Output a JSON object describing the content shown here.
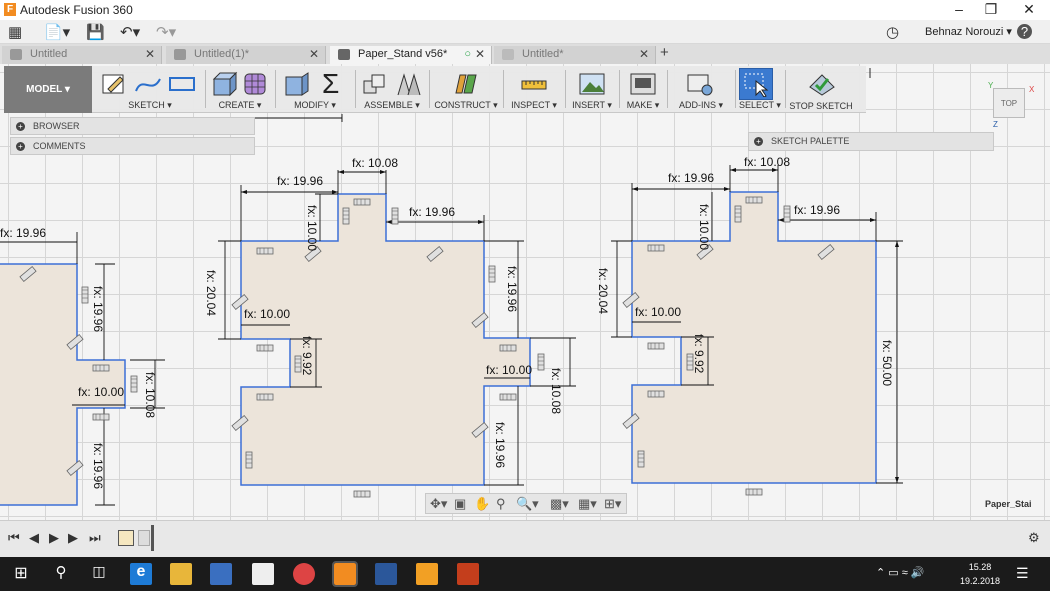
{
  "window": {
    "title": "Autodesk Fusion 360",
    "app_icon": "F"
  },
  "quick_access": {
    "user_name": "Behnaz Norouzi",
    "help": "?"
  },
  "tabs": [
    {
      "label": "Untitled",
      "active": false
    },
    {
      "label": "Untitled(1)*",
      "active": false
    },
    {
      "label": "Paper_Stand v56*",
      "active": true
    },
    {
      "label": "Untitled*",
      "active": false
    }
  ],
  "toolbar": {
    "workspace": "MODEL",
    "groups": [
      "SKETCH",
      "CREATE",
      "MODIFY",
      "ASSEMBLE",
      "CONSTRUCT",
      "INSPECT",
      "INSERT",
      "MAKE",
      "ADD-INS",
      "SELECT",
      "STOP SKETCH"
    ]
  },
  "panels": {
    "browser": "BROWSER",
    "comments": "COMMENTS",
    "sketch_palette": "SKETCH PALETTE"
  },
  "viewcube": {
    "face": "TOP",
    "axis_x": "X",
    "axis_y": "Y",
    "axis_z": "Z"
  },
  "document_name": "Paper_Stai",
  "dimensions": {
    "left": [
      "fx: 19.96",
      "fx: 19.96",
      "fx: 10.00",
      "fx: 10.08",
      "fx: 19.96"
    ],
    "middle": [
      "fx: 10.08",
      "fx: 19.96",
      "fx: 10.00",
      "fx: 19.96",
      "fx: 20.04",
      "fx: 19.96",
      "fx: 10.00",
      "fx: 9.92",
      "fx: 10.00",
      "fx: 10.08",
      "fx: 19.96"
    ],
    "right": [
      "fx: 10.08",
      "fx: 19.96",
      "fx: 10.00",
      "fx: 19.96",
      "fx: 20.04",
      "fx: 10.00",
      "fx: 9.92",
      "fx: 50.00"
    ]
  },
  "taskbar": {
    "time": "15.28",
    "date": "19.2.2018"
  },
  "colors": {
    "profile_fill": "#ece4da",
    "profile_line": "#3d6fd6",
    "accent": "#3a7bd5"
  }
}
